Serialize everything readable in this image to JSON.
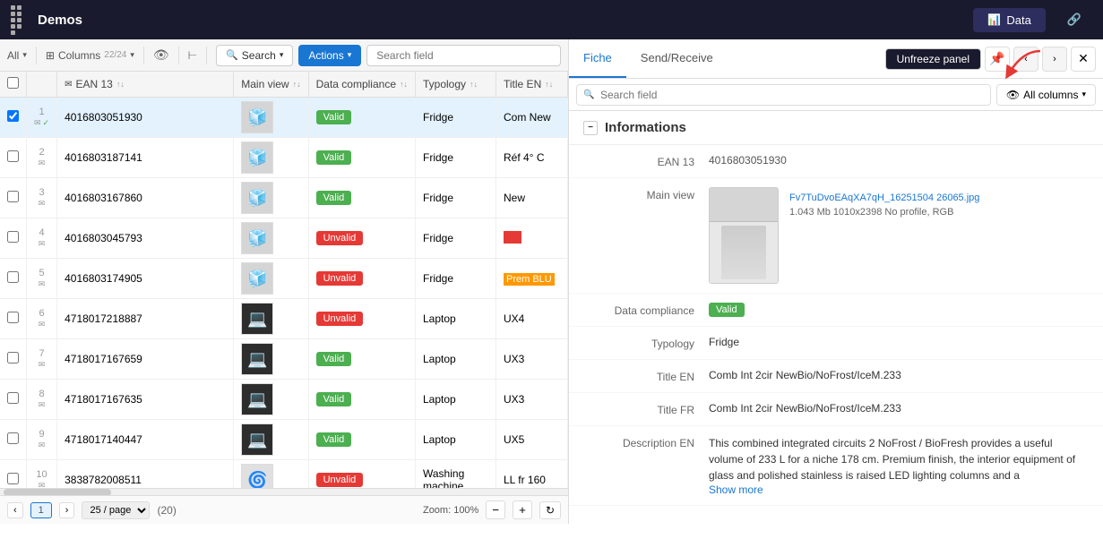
{
  "topbar": {
    "app_name": "Demos",
    "tabs": [
      {
        "id": "data",
        "label": "Data",
        "icon": "📊",
        "active": true
      },
      {
        "id": "other",
        "label": "",
        "icon": "🔗",
        "active": false
      }
    ]
  },
  "toolbar": {
    "all_label": "All",
    "columns_label": "Columns",
    "search_label": "Search",
    "actions_label": "Actions",
    "search_placeholder": "Search field",
    "count": "22/24"
  },
  "table": {
    "columns": [
      "",
      "",
      "EAN 13",
      "Main view",
      "Data compliance",
      "Typology",
      "Title EN"
    ],
    "rows": [
      {
        "num": 1,
        "ean": "4016803051930",
        "compliance": "Valid",
        "typology": "Fridge",
        "title": "Com New",
        "selected": true
      },
      {
        "num": 2,
        "ean": "4016803187141",
        "compliance": "Valid",
        "typology": "Fridge",
        "title": "Réf 4° C"
      },
      {
        "num": 3,
        "ean": "4016803167860",
        "compliance": "Valid",
        "typology": "Fridge",
        "title": "New"
      },
      {
        "num": 4,
        "ean": "4016803045793",
        "compliance": "Unvalid",
        "typology": "Fridge",
        "title": ""
      },
      {
        "num": 5,
        "ean": "4016803174905",
        "compliance": "Unvalid",
        "typology": "Fridge",
        "title": "Prem BLU"
      },
      {
        "num": 6,
        "ean": "4718017218887",
        "compliance": "Unvalid",
        "typology": "Laptop",
        "title": "UX4"
      },
      {
        "num": 7,
        "ean": "4718017167659",
        "compliance": "Valid",
        "typology": "Laptop",
        "title": "UX3"
      },
      {
        "num": 8,
        "ean": "4718017167635",
        "compliance": "Valid",
        "typology": "Laptop",
        "title": "UX3"
      },
      {
        "num": 9,
        "ean": "4718017140447",
        "compliance": "Valid",
        "typology": "Laptop",
        "title": "UX5"
      },
      {
        "num": 10,
        "ean": "3838782008511",
        "compliance": "Unvalid",
        "typology": "Washing machine",
        "title": "LL fr 160"
      }
    ]
  },
  "footer": {
    "prev_label": "‹",
    "current_page": "1",
    "next_label": "›",
    "per_page": "25 / page",
    "total": "(20)",
    "zoom_label": "Zoom: 100%",
    "zoom_out": "−",
    "zoom_in": "+"
  },
  "right_panel": {
    "tabs": [
      "Fiche",
      "Send/Receive"
    ],
    "unfreeze_label": "Unfreeze panel",
    "search_placeholder": "Search field",
    "all_columns_label": "All columns",
    "section": {
      "title": "Informations",
      "fields": {
        "ean13_label": "EAN 13",
        "ean13_value": "4016803051930",
        "main_view_label": "Main view",
        "img_link": "Fv7TuDvoEAqXA7qH_16251504 26065.jpg",
        "img_meta": "1.043 Mb  1010x2398  No profile, RGB",
        "data_compliance_label": "Data compliance",
        "data_compliance_value": "Valid",
        "typology_label": "Typology",
        "typology_value": "Fridge",
        "title_en_label": "Title EN",
        "title_en_value": "Comb Int 2cir NewBio/NoFrost/IceM.233",
        "title_fr_label": "Title FR",
        "title_fr_value": "Comb Int 2cir NewBio/NoFrost/IceM.233",
        "description_en_label": "Description EN",
        "description_en_value": "This combined integrated circuits 2 NoFrost / BioFresh provides a useful volume of 233 L for a niche 178 cm. Premium finish, the interior equipment of glass and polished stainless is raised LED lighting columns and a",
        "show_more": "Show more"
      }
    }
  }
}
